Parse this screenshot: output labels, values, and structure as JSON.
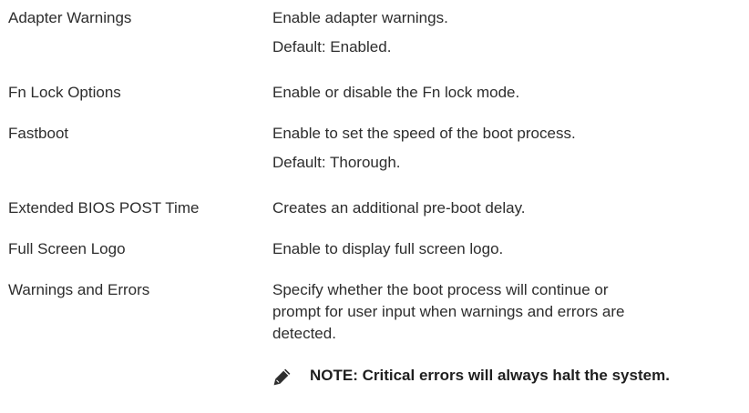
{
  "rows": [
    {
      "option": "Adapter Warnings",
      "lines": [
        "Enable adapter warnings.",
        "Default: Enabled."
      ]
    },
    {
      "option": "Fn Lock Options",
      "lines": [
        "Enable or disable the Fn lock mode."
      ]
    },
    {
      "option": "Fastboot",
      "lines": [
        "Enable to set the speed of the boot process.",
        "Default: Thorough."
      ]
    },
    {
      "option": "Extended BIOS POST Time",
      "lines": [
        "Creates an additional pre-boot delay."
      ]
    },
    {
      "option": "Full Screen Logo",
      "lines": [
        "Enable to display full screen logo."
      ]
    },
    {
      "option": "Warnings and Errors",
      "lines": [
        "Specify whether the boot process will continue or",
        "prompt for user input when warnings and errors are",
        "detected."
      ]
    }
  ],
  "note": {
    "icon": "pencil-icon",
    "text": "NOTE: Critical errors will always halt the system."
  }
}
